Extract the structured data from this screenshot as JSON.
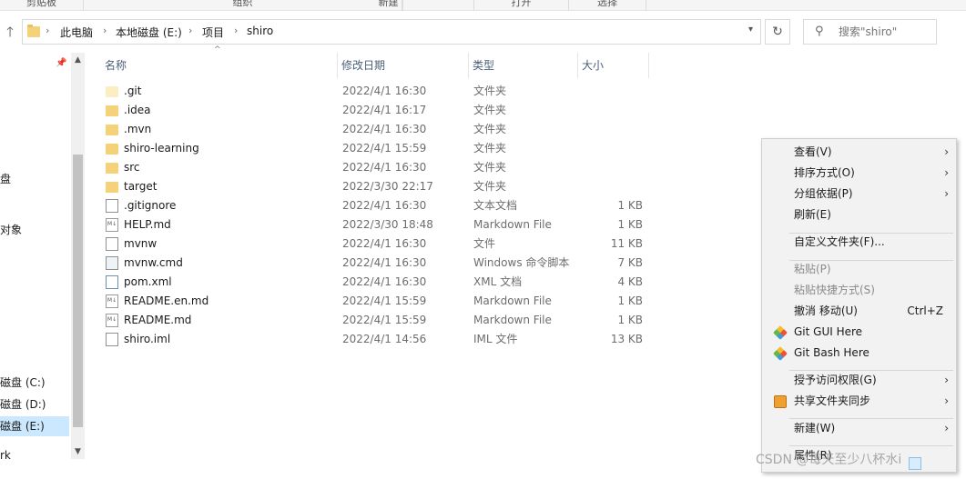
{
  "ribbon": {
    "groups": [
      "剪贴板",
      "组织",
      "新建",
      "打开",
      "选择"
    ]
  },
  "address_bar": {
    "breadcrumbs": [
      "此电脑",
      "本地磁盘 (E:)",
      "项目",
      "shiro"
    ],
    "search_placeholder": "搜索\"shiro\""
  },
  "nav_pane": {
    "items": [
      {
        "label": "盘",
        "selected": false
      },
      {
        "label": "对象",
        "selected": false
      },
      {
        "label": "磁盘 (C:)",
        "selected": false
      },
      {
        "label": "磁盘 (D:)",
        "selected": false
      },
      {
        "label": "磁盘 (E:)",
        "selected": true
      },
      {
        "label": "rk",
        "selected": false
      }
    ]
  },
  "columns": {
    "name": "名称",
    "date": "修改日期",
    "type": "类型",
    "size": "大小"
  },
  "files": [
    {
      "name": ".git",
      "date": "2022/4/1 16:30",
      "type": "文件夹",
      "size": "",
      "icon": "folder-faint-icon"
    },
    {
      "name": ".idea",
      "date": "2022/4/1 16:17",
      "type": "文件夹",
      "size": "",
      "icon": "folder-icon"
    },
    {
      "name": ".mvn",
      "date": "2022/4/1 16:30",
      "type": "文件夹",
      "size": "",
      "icon": "folder-icon"
    },
    {
      "name": "shiro-learning",
      "date": "2022/4/1 15:59",
      "type": "文件夹",
      "size": "",
      "icon": "folder-icon"
    },
    {
      "name": "src",
      "date": "2022/4/1 16:30",
      "type": "文件夹",
      "size": "",
      "icon": "folder-icon"
    },
    {
      "name": "target",
      "date": "2022/3/30 22:17",
      "type": "文件夹",
      "size": "",
      "icon": "folder-icon"
    },
    {
      "name": ".gitignore",
      "date": "2022/4/1 16:30",
      "type": "文本文档",
      "size": "1 KB",
      "icon": "text-file-icon"
    },
    {
      "name": "HELP.md",
      "date": "2022/3/30 18:48",
      "type": "Markdown File",
      "size": "1 KB",
      "icon": "markdown-file-icon"
    },
    {
      "name": "mvnw",
      "date": "2022/4/1 16:30",
      "type": "文件",
      "size": "11 KB",
      "icon": "file-icon"
    },
    {
      "name": "mvnw.cmd",
      "date": "2022/4/1 16:30",
      "type": "Windows 命令脚本",
      "size": "7 KB",
      "icon": "cmd-file-icon"
    },
    {
      "name": "pom.xml",
      "date": "2022/4/1 16:30",
      "type": "XML 文档",
      "size": "4 KB",
      "icon": "xml-file-icon"
    },
    {
      "name": "README.en.md",
      "date": "2022/4/1 15:59",
      "type": "Markdown File",
      "size": "1 KB",
      "icon": "markdown-file-icon"
    },
    {
      "name": "README.md",
      "date": "2022/4/1 15:59",
      "type": "Markdown File",
      "size": "1 KB",
      "icon": "markdown-file-icon"
    },
    {
      "name": "shiro.iml",
      "date": "2022/4/1 14:56",
      "type": "IML 文件",
      "size": "13 KB",
      "icon": "file-icon"
    }
  ],
  "context_menu": {
    "items": [
      {
        "label": "查看(V)",
        "submenu": true,
        "disabled": false
      },
      {
        "label": "排序方式(O)",
        "submenu": true,
        "disabled": false
      },
      {
        "label": "分组依据(P)",
        "submenu": true,
        "disabled": false
      },
      {
        "label": "刷新(E)",
        "submenu": false,
        "disabled": false
      },
      {
        "label": "自定义文件夹(F)...",
        "submenu": false,
        "disabled": false
      },
      {
        "label": "粘贴(P)",
        "submenu": false,
        "disabled": true
      },
      {
        "label": "粘贴快捷方式(S)",
        "submenu": false,
        "disabled": true
      },
      {
        "label": "撤消 移动(U)",
        "submenu": false,
        "disabled": false,
        "shortcut": "Ctrl+Z"
      },
      {
        "label": "Git GUI Here",
        "submenu": false,
        "disabled": false,
        "icon": "git-icon"
      },
      {
        "label": "Git Bash Here",
        "submenu": false,
        "disabled": false,
        "icon": "git-icon"
      },
      {
        "label": "授予访问权限(G)",
        "submenu": true,
        "disabled": false
      },
      {
        "label": "共享文件夹同步",
        "submenu": true,
        "disabled": false,
        "icon": "share-sync-icon"
      },
      {
        "label": "新建(W)",
        "submenu": true,
        "disabled": false
      },
      {
        "label": "属性(R)",
        "submenu": false,
        "disabled": false
      }
    ]
  },
  "watermark": "CSDN @每天至少八杯水i",
  "colors": {
    "selection": "#cce8ff",
    "folder": "#f5d27a",
    "header_text": "#4c607a",
    "menu_bg": "#f2f2f2"
  }
}
